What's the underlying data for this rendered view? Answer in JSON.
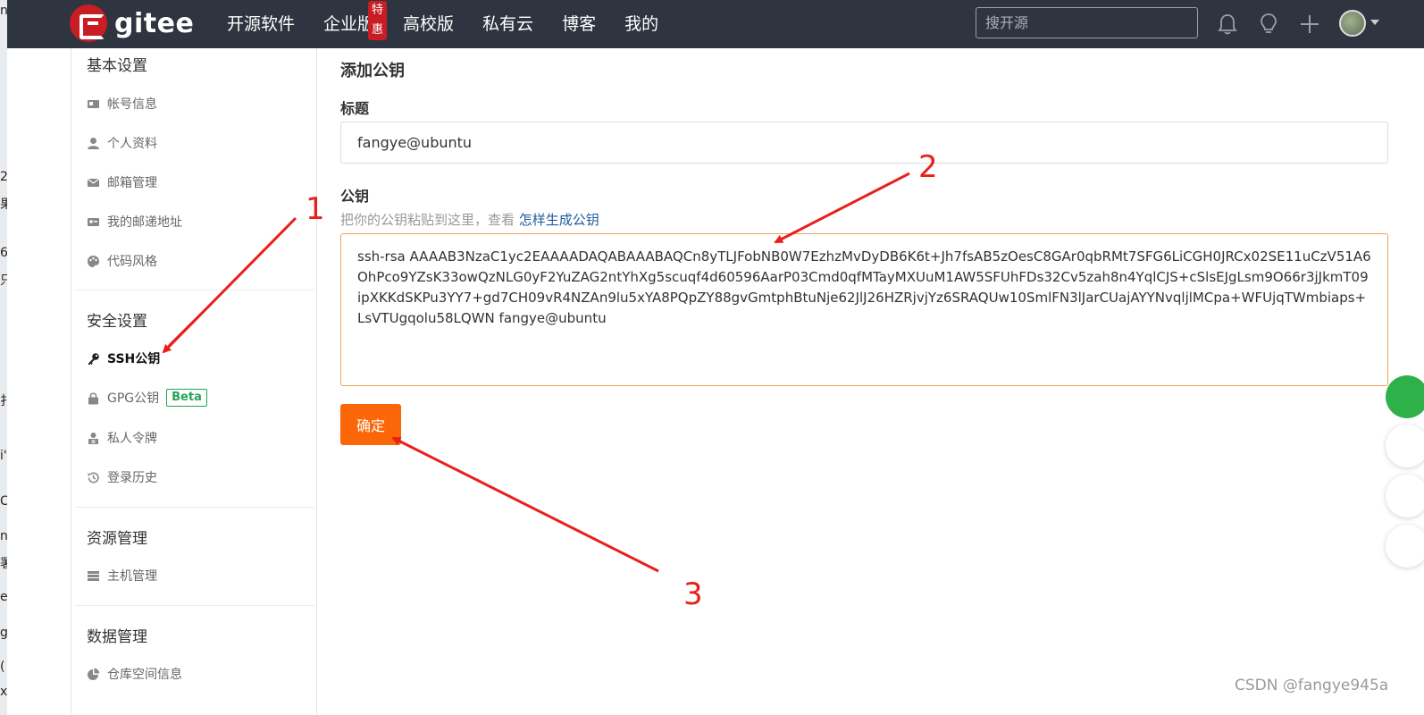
{
  "left_strip": [
    "n",
    "2",
    "果",
    "6",
    "只",
    "扌",
    "i'",
    "C",
    "n",
    "署",
    "e",
    "g",
    "(",
    "xt"
  ],
  "header": {
    "logo_text": "gitee",
    "nav": [
      {
        "label": "开源软件"
      },
      {
        "label": "企业版",
        "badge": "特惠"
      },
      {
        "label": "高校版"
      },
      {
        "label": "私有云"
      },
      {
        "label": "博客"
      },
      {
        "label": "我的"
      }
    ],
    "search_placeholder": "搜开源"
  },
  "sidebar": {
    "sections": [
      {
        "title": "基本设置",
        "items": [
          {
            "label": "帐号信息",
            "icon": "id-card-icon"
          },
          {
            "label": "个人资料",
            "icon": "user-icon"
          },
          {
            "label": "邮箱管理",
            "icon": "envelope-icon"
          },
          {
            "label": "我的邮递地址",
            "icon": "address-card-icon"
          },
          {
            "label": "代码风格",
            "icon": "palette-icon"
          }
        ]
      },
      {
        "title": "安全设置",
        "items": [
          {
            "label": "SSH公钥",
            "icon": "key-icon",
            "active": true
          },
          {
            "label": "GPG公钥",
            "icon": "lock-icon",
            "badge": "Beta"
          },
          {
            "label": "私人令牌",
            "icon": "token-icon"
          },
          {
            "label": "登录历史",
            "icon": "history-icon"
          }
        ]
      },
      {
        "title": "资源管理",
        "items": [
          {
            "label": "主机管理",
            "icon": "server-icon"
          }
        ]
      },
      {
        "title": "数据管理",
        "items": [
          {
            "label": "仓库空间信息",
            "icon": "pie-chart-icon"
          }
        ]
      }
    ]
  },
  "main": {
    "title": "添加公钥",
    "title_field_label": "标题",
    "title_field_value": "fangye@ubuntu",
    "key_field_label": "公钥",
    "key_hint": "把你的公钥粘贴到这里，查看",
    "key_hint_link": "怎样生成公钥",
    "key_value": "ssh-rsa AAAAB3NzaC1yc2EAAAADAQABAAABAQCn8yTLJFobNB0W7EzhzMvDyDB6K6t+Jh7fsAB5zOesC8GAr0qbRMt7SFG6LiCGH0JRCx02SE11uCzV51A6OhPco9YZsK33owQzNLG0yF2YuZAG2ntYhXg5scuqf4d60596AarP03Cmd0qfMTayMXUuM1AW5SFUhFDs32Cv5zah8n4YqlCJS+cSlsEJgLsm9O66r3jJkmT09ipXKKdSKPu3YY7+gd7CH09vR4NZAn9lu5xYA8PQpZY88gvGmtphBtuNje62JlJ26HZRjvjYz6SRAQUw10SmlFN3lJarCUajAYYNvqljlMCpa+WFUjqTWmbiaps+LsVTUgqolu58LQWN fangye@ubuntu",
    "confirm_label": "确定"
  },
  "annotations": {
    "labels": [
      "1",
      "2",
      "3"
    ],
    "color": "#e8201c"
  },
  "watermark": "CSDN @fangye945a",
  "colors": {
    "header_bg": "#2e3440",
    "brand_red": "#c71d23",
    "confirm_orange": "#fa6608",
    "beta_green": "#21a557",
    "link_blue": "#1f5c9a"
  }
}
